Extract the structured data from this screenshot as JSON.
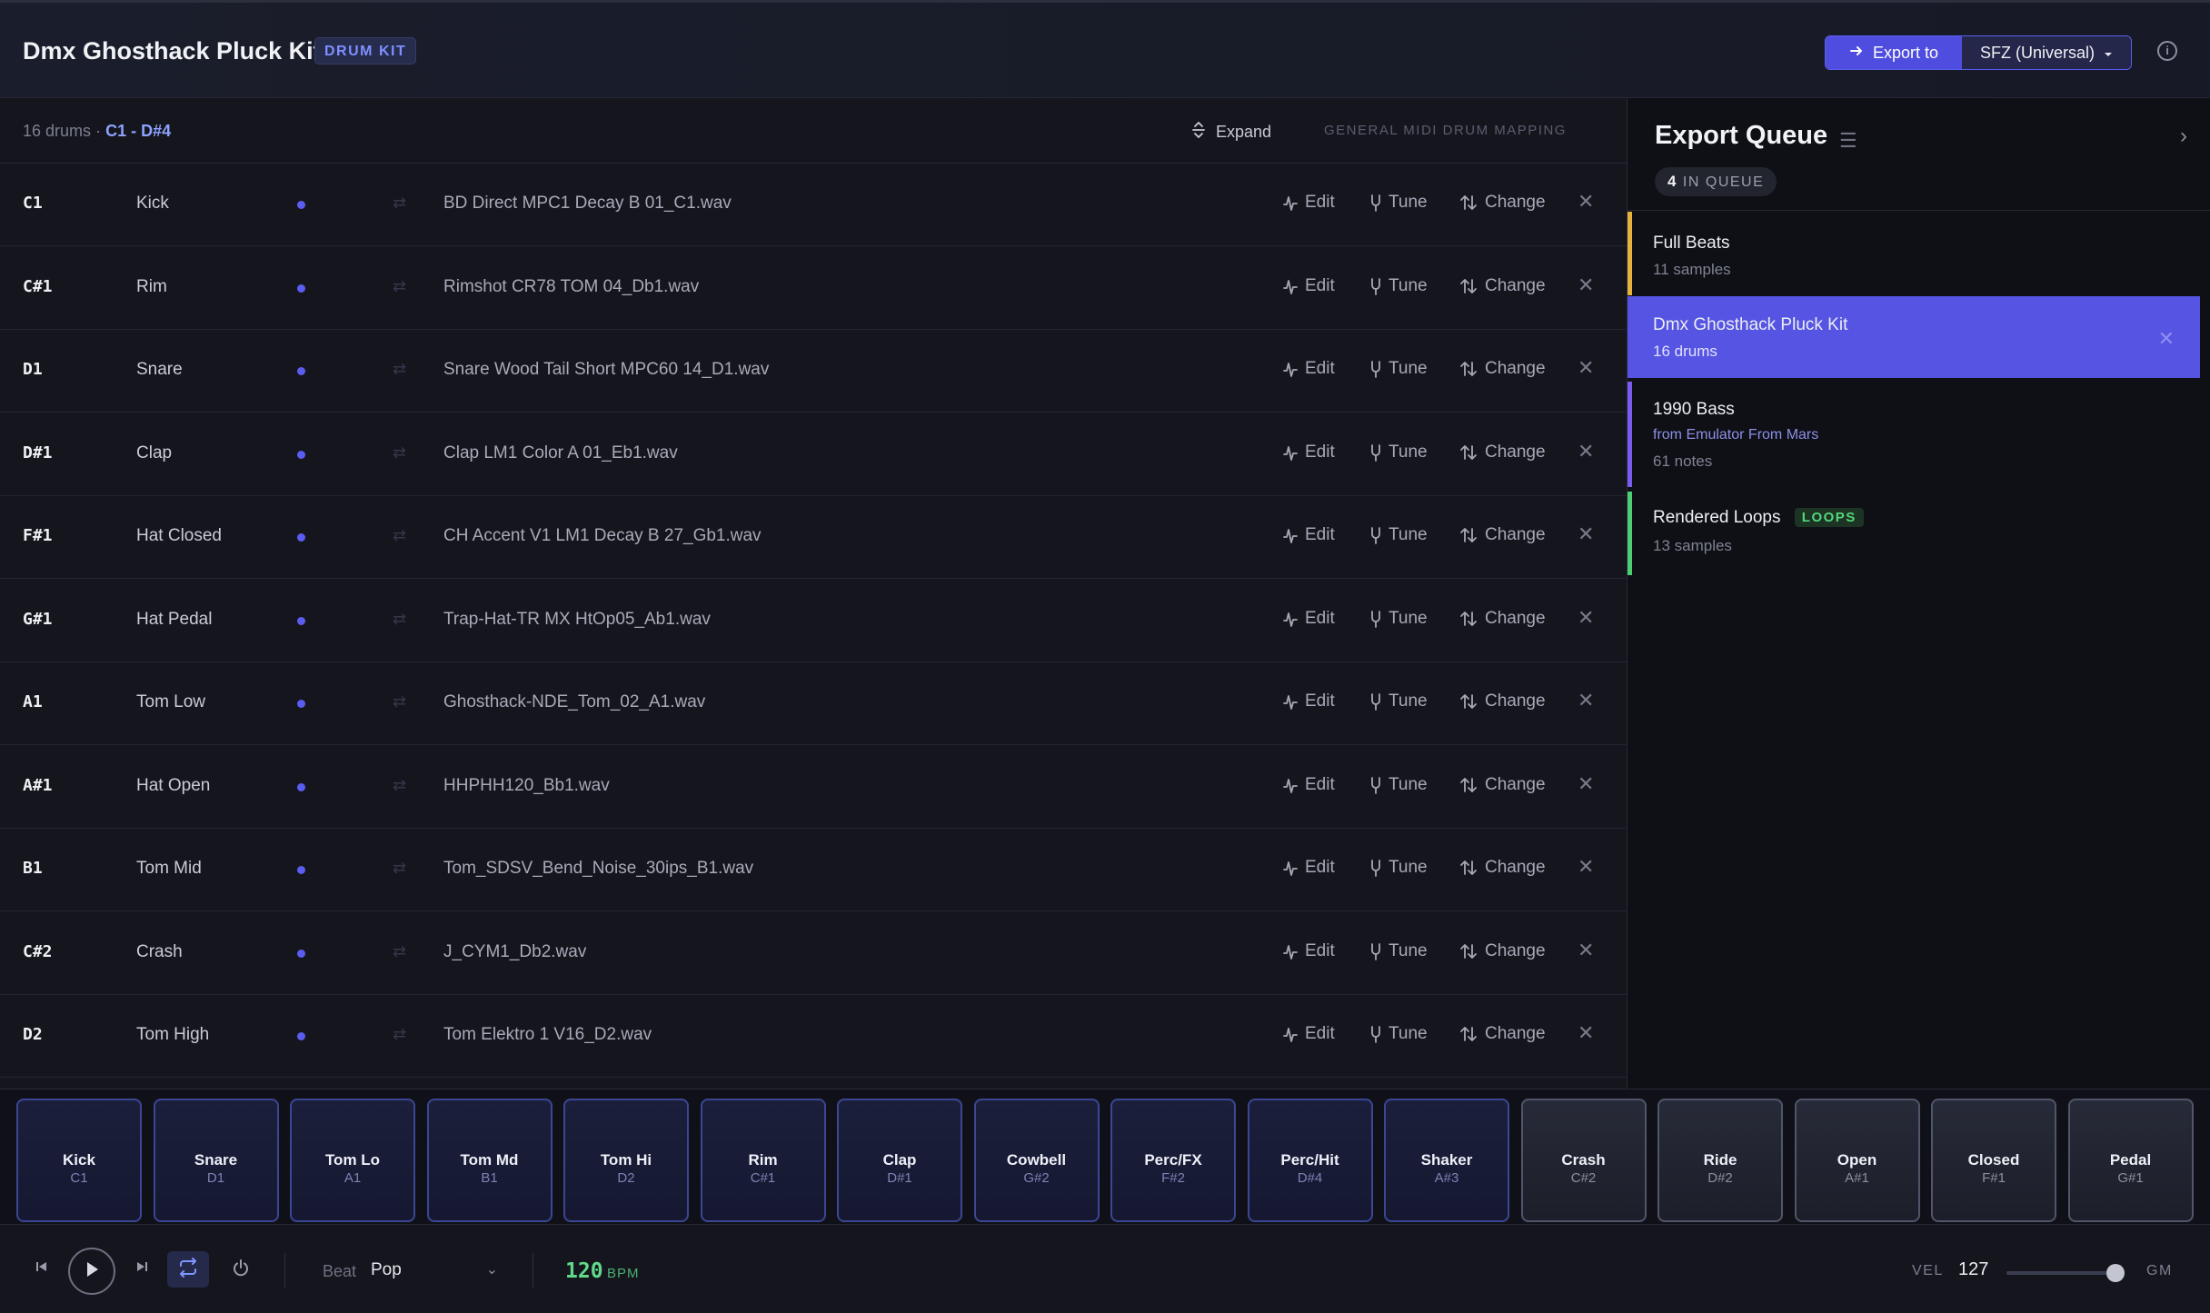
{
  "header": {
    "title": "Dmx Ghosthack Pluck Kit",
    "badge": "DRUM KIT",
    "export_label": "Export to",
    "format_value": "SFZ (Universal)"
  },
  "list": {
    "count_text": "16 drums",
    "separator": "·",
    "range": "C1 - D#4",
    "expand_label": "Expand",
    "mapping_label": "GENERAL MIDI DRUM MAPPING",
    "action_edit": "Edit",
    "action_tune": "Tune",
    "action_change": "Change",
    "rows": [
      {
        "note": "C1",
        "name": "Kick",
        "file": "BD Direct MPC1 Decay B 01_C1.wav"
      },
      {
        "note": "C#1",
        "name": "Rim",
        "file": "Rimshot CR78 TOM 04_Db1.wav"
      },
      {
        "note": "D1",
        "name": "Snare",
        "file": "Snare Wood Tail Short MPC60 14_D1.wav"
      },
      {
        "note": "D#1",
        "name": "Clap",
        "file": "Clap LM1 Color A 01_Eb1.wav"
      },
      {
        "note": "F#1",
        "name": "Hat Closed",
        "file": "CH Accent V1 LM1 Decay B 27_Gb1.wav"
      },
      {
        "note": "G#1",
        "name": "Hat Pedal",
        "file": "Trap-Hat-TR MX HtOp05_Ab1.wav"
      },
      {
        "note": "A1",
        "name": "Tom Low",
        "file": "Ghosthack-NDE_Tom_02_A1.wav"
      },
      {
        "note": "A#1",
        "name": "Hat Open",
        "file": "HHPHH120_Bb1.wav"
      },
      {
        "note": "B1",
        "name": "Tom Mid",
        "file": "Tom_SDSV_Bend_Noise_30ips_B1.wav"
      },
      {
        "note": "C#2",
        "name": "Crash",
        "file": "J_CYM1_Db2.wav"
      },
      {
        "note": "D2",
        "name": "Tom High",
        "file": "Tom Elektro 1 V16_D2.wav"
      }
    ]
  },
  "sidebar": {
    "title": "Export Queue",
    "queue_count": "4",
    "queue_label": "IN QUEUE",
    "items": [
      {
        "name": "Full Beats",
        "sub": "11 samples",
        "accent": "#e6b43c"
      },
      {
        "name": "Dmx Ghosthack Pluck Kit",
        "sub": "16 drums",
        "accent": "#5654e2",
        "active": true
      },
      {
        "name": "1990 Bass",
        "source": "from Emulator From Mars",
        "sub": "61 notes",
        "accent": "#7b5cf0"
      },
      {
        "name": "Rendered Loops",
        "tag": "LOOPS",
        "sub": "13 samples",
        "accent": "#4ccf73"
      }
    ]
  },
  "pads": [
    {
      "name": "Kick",
      "note": "C1",
      "style": "blue"
    },
    {
      "name": "Snare",
      "note": "D1",
      "style": "blue"
    },
    {
      "name": "Tom Lo",
      "note": "A1",
      "style": "blue"
    },
    {
      "name": "Tom Md",
      "note": "B1",
      "style": "blue"
    },
    {
      "name": "Tom Hi",
      "note": "D2",
      "style": "blue"
    },
    {
      "name": "Rim",
      "note": "C#1",
      "style": "blue"
    },
    {
      "name": "Clap",
      "note": "D#1",
      "style": "blue"
    },
    {
      "name": "Cowbell",
      "note": "G#2",
      "style": "blue"
    },
    {
      "name": "Perc/FX",
      "note": "F#2",
      "style": "blue"
    },
    {
      "name": "Perc/Hit",
      "note": "D#4",
      "style": "blue"
    },
    {
      "name": "Shaker",
      "note": "A#3",
      "style": "blue"
    },
    {
      "name": "Crash",
      "note": "C#2",
      "style": "gray"
    },
    {
      "name": "Ride",
      "note": "D#2",
      "style": "gray"
    },
    {
      "name": "Open",
      "note": "A#1",
      "style": "gray"
    },
    {
      "name": "Closed",
      "note": "F#1",
      "style": "gray"
    },
    {
      "name": "Pedal",
      "note": "G#1",
      "style": "gray"
    }
  ],
  "transport": {
    "beat_label": "Beat",
    "beat_value": "Pop",
    "bpm": "120",
    "bpm_unit": "BPM",
    "vel_label": "VEL",
    "vel_value": "127",
    "vel_fraction": 1.0,
    "gm_label": "GM"
  },
  "colors": {
    "accent": "#5654e2",
    "bpm_green": "#62d98a",
    "dot": "#5a5df0"
  },
  "icons": {
    "export": "arrow-right-icon",
    "info": "info-icon",
    "expand": "expand-icon",
    "edit": "waveform-icon",
    "tune": "tuning-fork-icon",
    "change": "swap-icon",
    "remove": "close-icon",
    "loop": "loop-icon",
    "menu": "list-icon",
    "collapse": "chevron-right-icon"
  }
}
